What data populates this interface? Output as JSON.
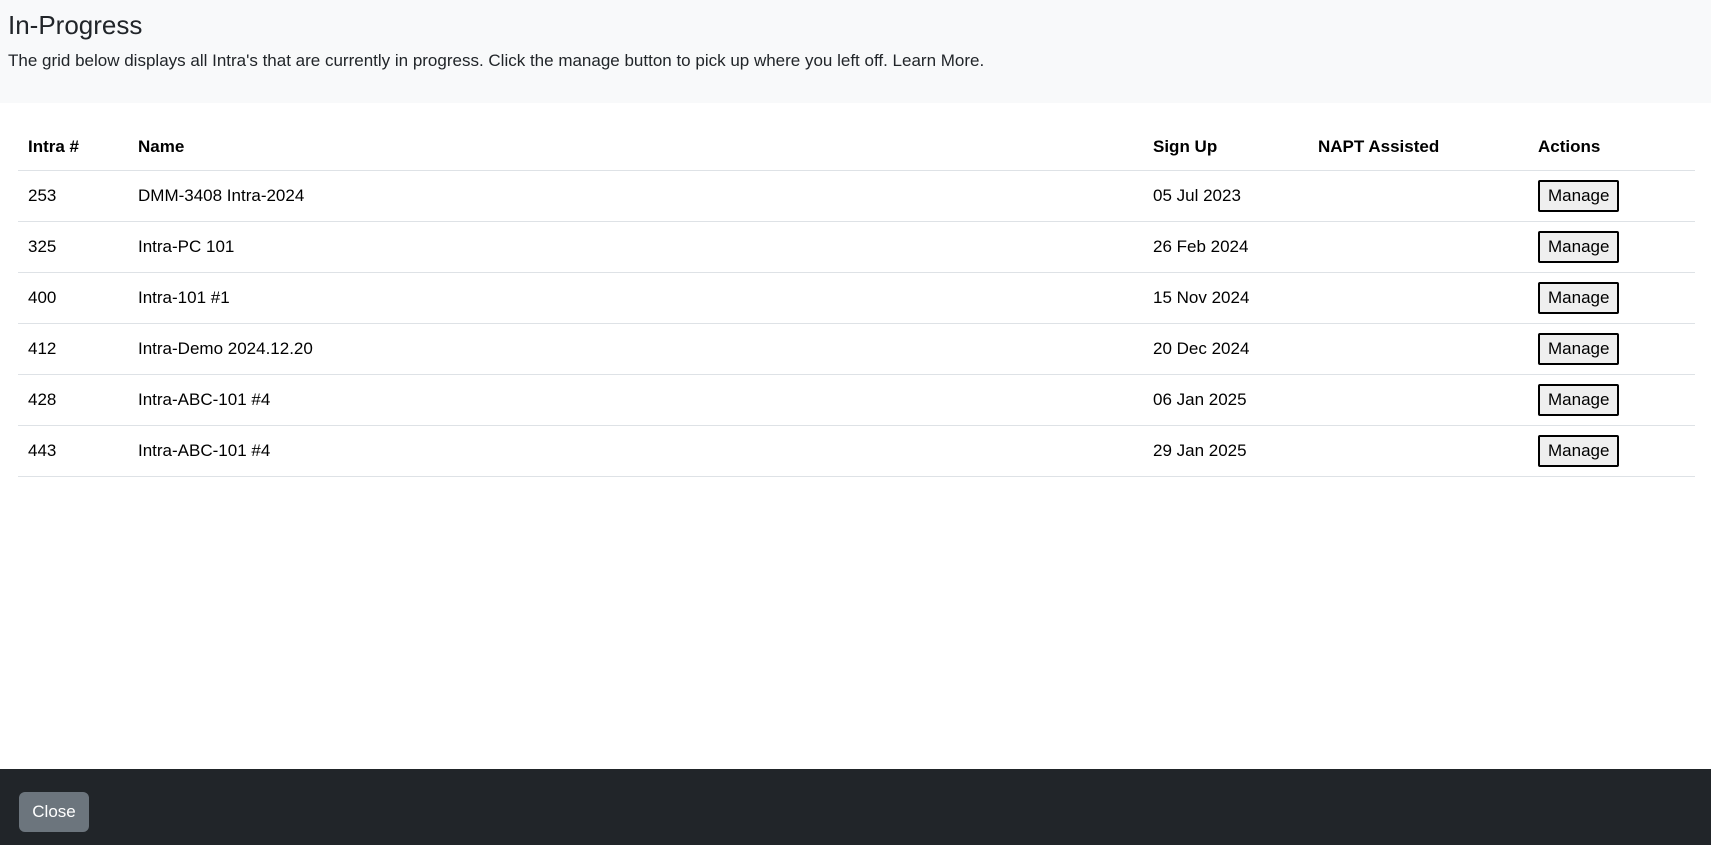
{
  "header": {
    "title": "In-Progress",
    "description": "The grid below displays all Intra's that are currently in progress. Click the manage button to pick up where you left off. Learn More."
  },
  "grid": {
    "columns": [
      "Intra #",
      "Name",
      "Sign Up",
      "NAPT Assisted",
      "Actions"
    ],
    "rows": [
      {
        "num": "253",
        "name": "DMM-3408 Intra-2024",
        "signup": "05 Jul 2023",
        "napt": "",
        "action": "Manage"
      },
      {
        "num": "325",
        "name": "Intra-PC 101",
        "signup": "26 Feb 2024",
        "napt": "",
        "action": "Manage"
      },
      {
        "num": "400",
        "name": "Intra-101 #1",
        "signup": "15 Nov 2024",
        "napt": "",
        "action": "Manage"
      },
      {
        "num": "412",
        "name": "Intra-Demo 2024.12.20",
        "signup": "20 Dec 2024",
        "napt": "",
        "action": "Manage"
      },
      {
        "num": "428",
        "name": "Intra-ABC-101 #4",
        "signup": "06 Jan 2025",
        "napt": "",
        "action": "Manage"
      },
      {
        "num": "443",
        "name": "Intra-ABC-101 #4",
        "signup": "29 Jan 2025",
        "napt": "",
        "action": "Manage"
      }
    ]
  },
  "footer": {
    "close_label": "Close"
  },
  "colors": {
    "header_bg": "#f8f9fa",
    "footer_bg": "#212529",
    "close_button_bg": "#6c757d"
  }
}
